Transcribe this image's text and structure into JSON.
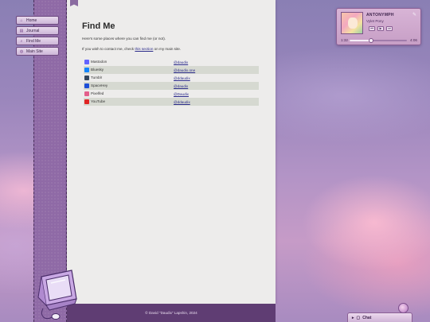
{
  "nav": {
    "items": [
      {
        "label": "Home",
        "icon": "home-icon"
      },
      {
        "label": "Journal",
        "icon": "journal-icon"
      },
      {
        "label": "Find Me",
        "icon": "search-icon"
      },
      {
        "label": "Main Site",
        "icon": "globe-icon"
      }
    ]
  },
  "page": {
    "title": "Find Me",
    "intro": "Here's some places where you can find me (or not).",
    "contact_prefix": "If you wish to contact me, check ",
    "contact_link": "this section",
    "contact_suffix": " on my main site."
  },
  "links": [
    {
      "site": "Mastodon",
      "handle": "@daudix",
      "color": "#6364ff"
    },
    {
      "site": "Bluesky",
      "handle": "@daudix.one",
      "color": "#1185fe"
    },
    {
      "site": "Tumblr",
      "handle": "@ddaudix",
      "color": "#35465c"
    },
    {
      "site": "SpaceHey",
      "handle": "@daudix",
      "color": "#1d4ed8"
    },
    {
      "site": "Pixelfed",
      "handle": "@Daudix",
      "color": "#e35f8b"
    },
    {
      "site": "YouTube",
      "handle": "@ddaudix",
      "color": "#e02424"
    }
  ],
  "footer": {
    "text": "© David \"Daudix\" Lapshin, 2024"
  },
  "player": {
    "track": "ANTONYMPH",
    "artist": "Vylet Pony",
    "elapsed": "1:32",
    "duration": "4:06",
    "progress": 0.374
  },
  "chat": {
    "label": "Chat"
  }
}
